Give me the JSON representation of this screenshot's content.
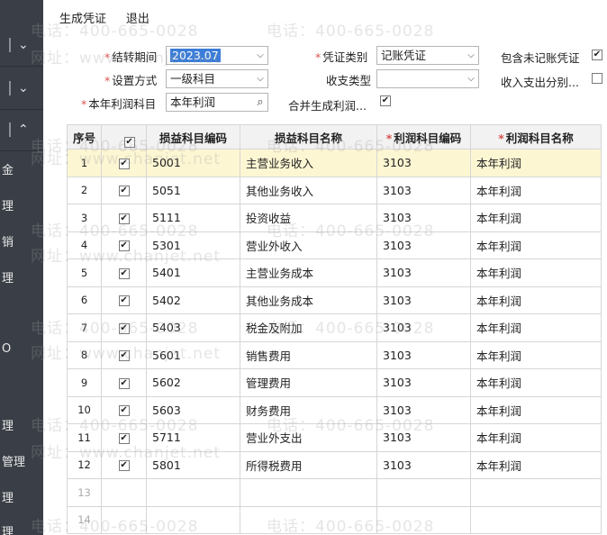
{
  "sidebar": {
    "arrows": [
      "⌄",
      "⌄",
      "⌃"
    ],
    "labels": [
      "金",
      "理",
      "销",
      "理",
      "O",
      "理",
      "管理",
      "理",
      "理"
    ]
  },
  "menu": {
    "generate": "生成凭证",
    "exit": "退出"
  },
  "form": {
    "period_label": "结转期间",
    "period_value": "2023.07",
    "voucher_label": "凭证类别",
    "voucher_value": "记账凭证",
    "include_unposted_label": "包含未记账凭证",
    "method_label": "设置方式",
    "method_value": "一级科目",
    "income_type_label": "收支类型",
    "income_type_value": "",
    "split_label": "收入支出分别...",
    "profit_label": "本年利润科目",
    "profit_value": "本年利润",
    "merge_label": "合并生成利润..."
  },
  "table": {
    "headers": [
      "序号",
      "",
      "损益科目编码",
      "损益科目名称",
      "利润科目编码",
      "利润科目名称"
    ],
    "rows": [
      {
        "no": "1",
        "code": "5001",
        "name": "主营业务收入",
        "pcode": "3103",
        "pname": "本年利润"
      },
      {
        "no": "2",
        "code": "5051",
        "name": "其他业务收入",
        "pcode": "3103",
        "pname": "本年利润"
      },
      {
        "no": "3",
        "code": "5111",
        "name": "投资收益",
        "pcode": "3103",
        "pname": "本年利润"
      },
      {
        "no": "4",
        "code": "5301",
        "name": "营业外收入",
        "pcode": "3103",
        "pname": "本年利润"
      },
      {
        "no": "5",
        "code": "5401",
        "name": "主营业务成本",
        "pcode": "3103",
        "pname": "本年利润"
      },
      {
        "no": "6",
        "code": "5402",
        "name": "其他业务成本",
        "pcode": "3103",
        "pname": "本年利润"
      },
      {
        "no": "7",
        "code": "5403",
        "name": "税金及附加",
        "pcode": "3103",
        "pname": "本年利润"
      },
      {
        "no": "8",
        "code": "5601",
        "name": "销售费用",
        "pcode": "3103",
        "pname": "本年利润"
      },
      {
        "no": "9",
        "code": "5602",
        "name": "管理费用",
        "pcode": "3103",
        "pname": "本年利润"
      },
      {
        "no": "10",
        "code": "5603",
        "name": "财务费用",
        "pcode": "3103",
        "pname": "本年利润"
      },
      {
        "no": "11",
        "code": "5711",
        "name": "营业外支出",
        "pcode": "3103",
        "pname": "本年利润"
      },
      {
        "no": "12",
        "code": "5801",
        "name": "所得税费用",
        "pcode": "3103",
        "pname": "本年利润"
      },
      {
        "no": "13",
        "code": "",
        "name": "",
        "pcode": "",
        "pname": ""
      },
      {
        "no": "14",
        "code": "",
        "name": "",
        "pcode": "",
        "pname": ""
      }
    ]
  },
  "watermark": {
    "phone": "电话：400-665-0028",
    "site": "网址：www.chanjet.net"
  }
}
